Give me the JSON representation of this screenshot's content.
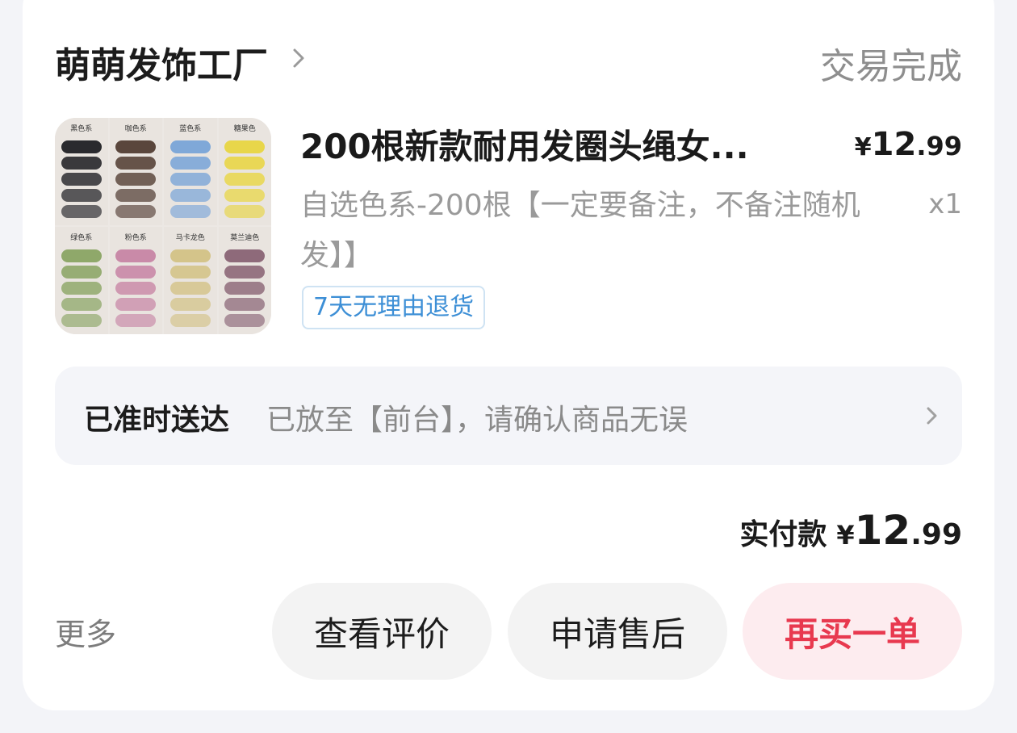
{
  "shop": {
    "name": "萌萌发饰工厂",
    "chevron_icon": "chevron-right-icon"
  },
  "order": {
    "status": "交易完成"
  },
  "product": {
    "title": "200根新款耐用发圈头绳女...",
    "price": {
      "currency": "¥",
      "integer": "12",
      "decimal": ".99"
    },
    "spec": "自选色系-200根【一定要备注，不备注随机发】】",
    "quantity": "x1",
    "tag": "7天无理由退货",
    "thumbnail_labels": [
      "黑色系",
      "咖色系",
      "蓝色系",
      "糖果色",
      "绿色系",
      "粉色系",
      "马卡龙色",
      "莫兰迪色"
    ],
    "thumbnail_colors": [
      "#2a2a2e",
      "#5a463c",
      "#7fa8d8",
      "#e8d64a",
      "#8fa86a",
      "#c98aa8",
      "#d4c48a",
      "#8e6a7a"
    ]
  },
  "delivery": {
    "label": "已准时送达",
    "text": "已放至【前台】，请确认商品无误",
    "chevron_icon": "chevron-right-icon"
  },
  "payment": {
    "label": "实付款",
    "currency": "¥",
    "integer": "12",
    "decimal": ".99"
  },
  "actions": {
    "more": "更多",
    "review": "查看评价",
    "after_sale": "申请售后",
    "rebuy": "再买一单"
  },
  "colors": {
    "accent_red": "#e8394f",
    "rebuy_bg": "#fdecef",
    "tag_blue": "#3d8fd6",
    "muted_text": "#9a9a9a"
  }
}
